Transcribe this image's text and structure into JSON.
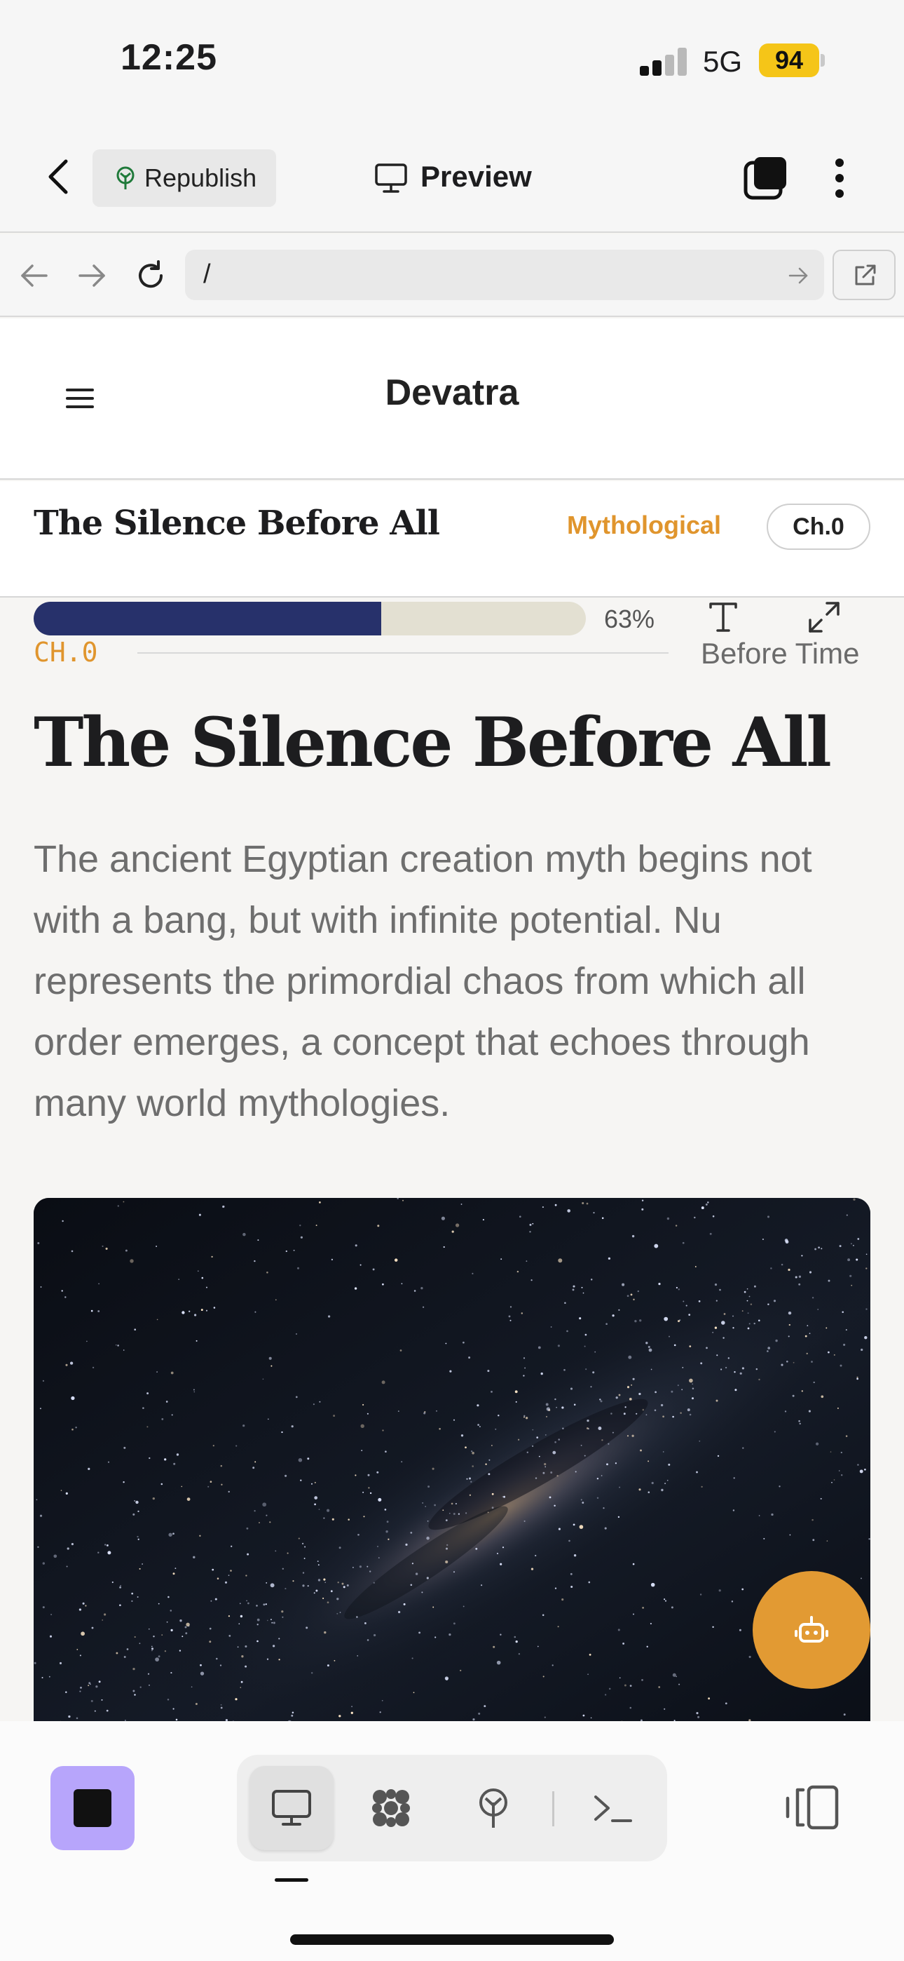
{
  "status_bar": {
    "time": "12:25",
    "network": "5G",
    "battery": "94"
  },
  "toolbar": {
    "republish_label": "Republish",
    "preview_label": "Preview"
  },
  "url_bar": {
    "path": "/"
  },
  "site": {
    "brand": "Devatra"
  },
  "chapter_bar": {
    "title": "The Silence Before All",
    "category": "Mythological",
    "chapter_pill": "Ch.0"
  },
  "reading": {
    "progress": 0.63,
    "progress_label": "63%",
    "chapter_tag": "CH.0",
    "section_title": "Before Time"
  },
  "article": {
    "title": "The Silence Before All",
    "lede": "The ancient Egyptian creation myth begins not with a bang, but with infinite potential. Nu represents the primordial chaos from which all order emerges, a concept that echoes through many world mythologies."
  },
  "colors": {
    "accent": "#e0952d",
    "progress_fill": "#27316b",
    "progress_track": "#e3e0d2",
    "stop_button": "#b7a5fb",
    "fab": "#e29a33"
  },
  "icons": {
    "toolbar": [
      "chevron-left-icon",
      "tree-icon",
      "monitor-icon",
      "tabs-icon",
      "more-vertical-icon"
    ],
    "url_bar": [
      "arrow-left-icon",
      "arrow-right-icon",
      "reload-icon",
      "arrow-right-icon",
      "external-link-icon"
    ],
    "reader": [
      "hamburger-menu-icon",
      "font-type-icon",
      "expand-icon",
      "robot-icon"
    ],
    "bottom_bar": [
      "stop-icon",
      "monitor-icon",
      "cluster-icon",
      "tree-icon",
      "terminal-icon",
      "panel-toggle-icon"
    ]
  }
}
